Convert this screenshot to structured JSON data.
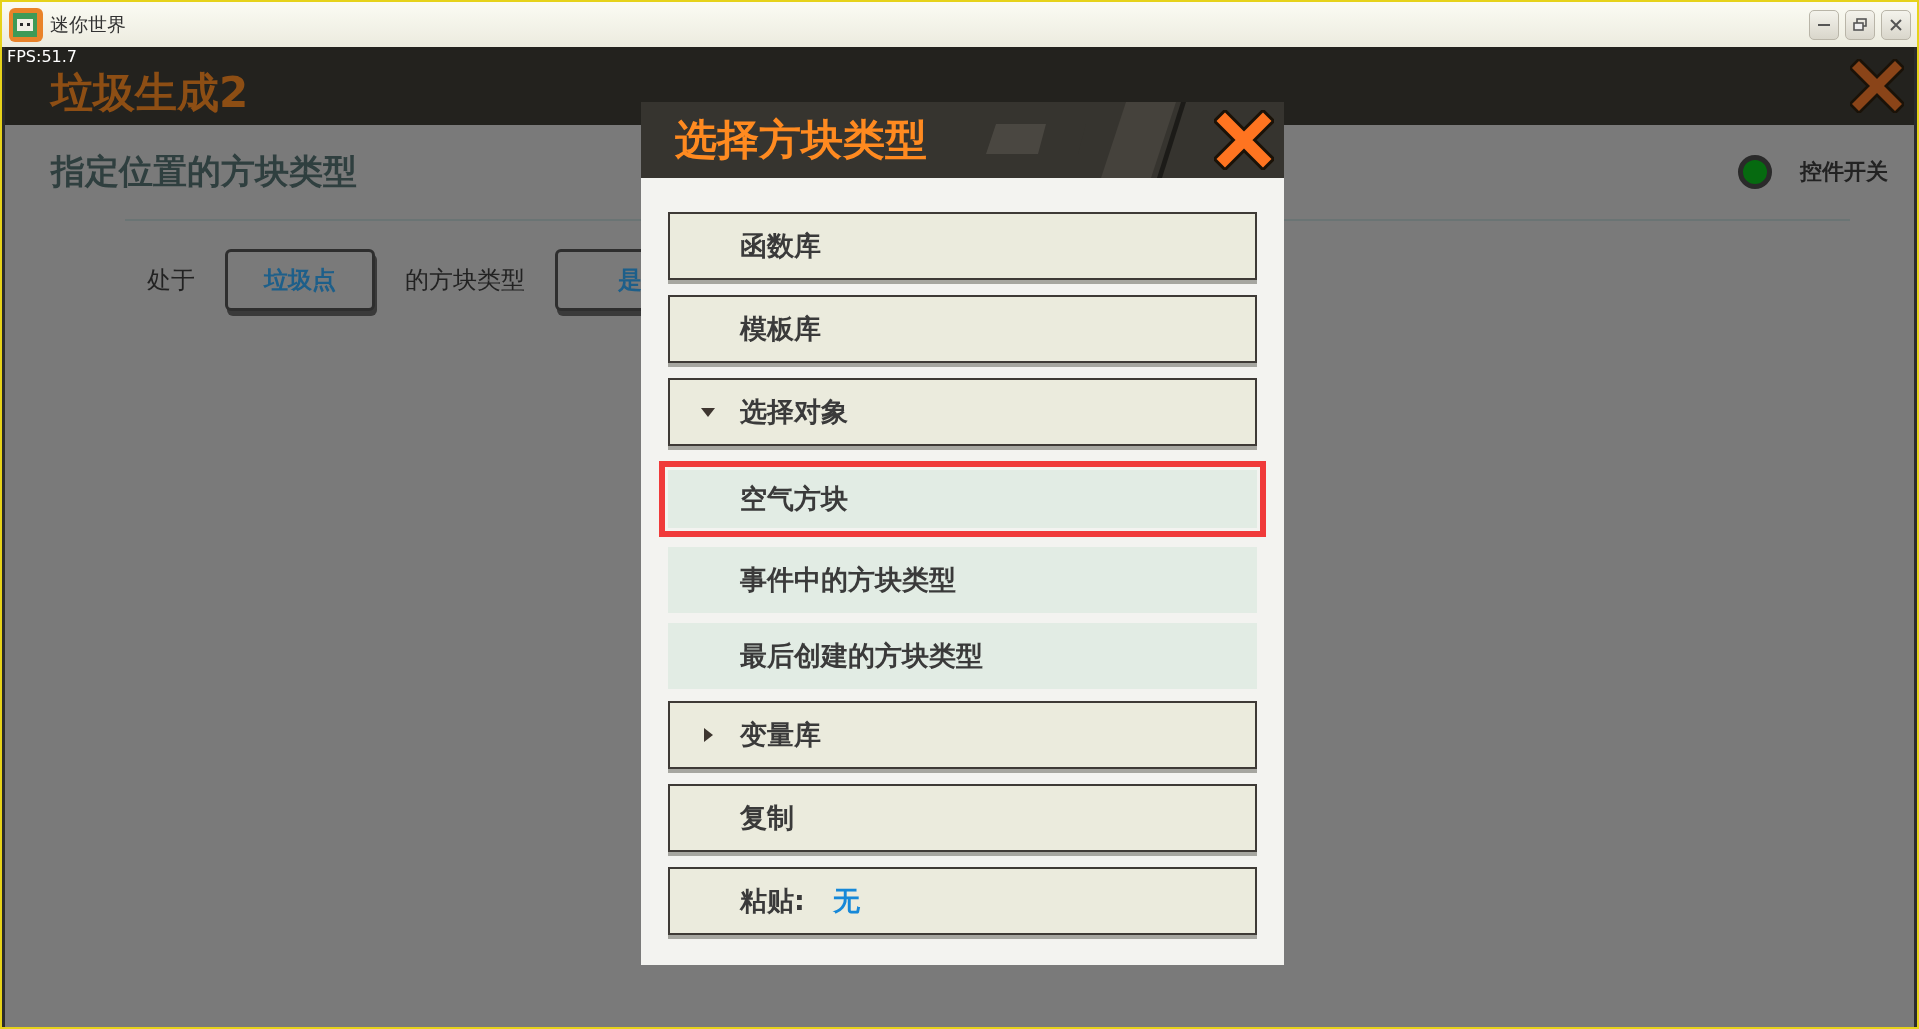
{
  "window": {
    "title": "迷你世界"
  },
  "fps": "FPS:51.7",
  "header": {
    "title": "垃圾生成2"
  },
  "panel": {
    "heading": "指定位置的方块类型",
    "toggle": {
      "label": "控件开关",
      "on": true
    },
    "sentence": [
      {
        "kind": "text",
        "text": "处于"
      },
      {
        "kind": "button",
        "text": "垃圾点"
      },
      {
        "kind": "text",
        "text": "的方块类型"
      },
      {
        "kind": "button",
        "text": "是"
      }
    ]
  },
  "dialog": {
    "title": "选择方块类型",
    "items": [
      {
        "kind": "action",
        "label": "函数库"
      },
      {
        "kind": "action",
        "label": "模板库"
      },
      {
        "kind": "group",
        "label": "选择对象",
        "expanded": true,
        "children": [
          {
            "label": "空气方块",
            "selected": true
          },
          {
            "label": "事件中的方块类型",
            "selected": false
          },
          {
            "label": "最后创建的方块类型",
            "selected": false
          }
        ]
      },
      {
        "kind": "group",
        "label": "变量库",
        "expanded": false
      },
      {
        "kind": "action",
        "label": "复制"
      },
      {
        "kind": "value",
        "label": "粘贴:",
        "value": "无"
      }
    ]
  }
}
